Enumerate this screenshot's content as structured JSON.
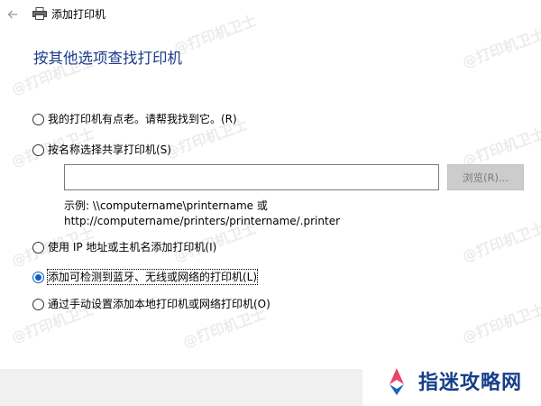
{
  "window": {
    "title": "添加打印机",
    "back_icon": "back-arrow-icon",
    "printer_icon": "printer-icon"
  },
  "heading": "按其他选项查找打印机",
  "options": {
    "old_printer": {
      "label": "我的打印机有点老。请帮我找到它。(R)",
      "selected": false
    },
    "shared_by_name": {
      "label": "按名称选择共享打印机(S)",
      "selected": false
    },
    "by_ip": {
      "label": "使用 IP 地址或主机名添加打印机(I)",
      "selected": false
    },
    "detectable": {
      "label": "添加可检测到蓝牙、无线或网络的打印机(L)",
      "selected": true
    },
    "manual_local": {
      "label": "通过手动设置添加本地打印机或网络打印机(O)",
      "selected": false
    }
  },
  "share_input": {
    "value": "",
    "placeholder": ""
  },
  "browse_button": {
    "label": "浏览(R)...",
    "enabled": false
  },
  "example": {
    "line1": "示例: \\\\computername\\printername 或",
    "line2": "http://computername/printers/printername/.printer"
  },
  "watermark": "@打印机卫士",
  "brand": {
    "name": "指迷攻略网",
    "logo_icon": "compass-logo-icon"
  },
  "colors": {
    "heading": "#1c3c8a",
    "radio_selected": "#0f5fc2",
    "brand": "#163e8a",
    "footer_bg": "#f0f0f0"
  }
}
